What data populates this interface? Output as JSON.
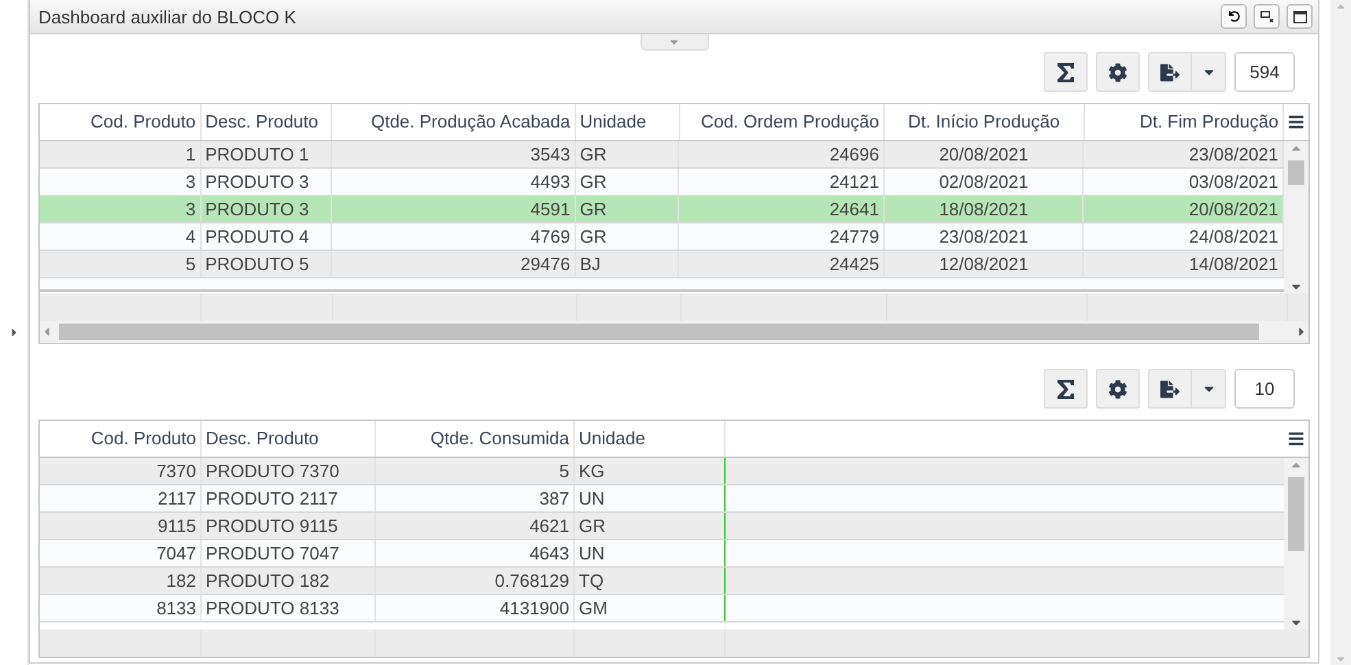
{
  "panel": {
    "title": "Dashboard auxiliar do BLOCO K"
  },
  "production_grid": {
    "record_count": "594",
    "columns": [
      "Cod. Produto",
      "Desc. Produto",
      "Qtde. Produção Acabada",
      "Unidade",
      "Cod. Ordem Produção",
      "Dt. Início Produção",
      "Dt. Fim Produção"
    ],
    "rows": [
      {
        "selected": false,
        "cells": [
          "1",
          "PRODUTO 1",
          "3543",
          "GR",
          "24696",
          "20/08/2021",
          "23/08/2021"
        ]
      },
      {
        "selected": false,
        "cells": [
          "3",
          "PRODUTO 3",
          "4493",
          "GR",
          "24121",
          "02/08/2021",
          "03/08/2021"
        ]
      },
      {
        "selected": true,
        "cells": [
          "3",
          "PRODUTO 3",
          "4591",
          "GR",
          "24641",
          "18/08/2021",
          "20/08/2021"
        ]
      },
      {
        "selected": false,
        "cells": [
          "4",
          "PRODUTO 4",
          "4769",
          "GR",
          "24779",
          "23/08/2021",
          "24/08/2021"
        ]
      },
      {
        "selected": false,
        "cells": [
          "5",
          "PRODUTO 5",
          "29476",
          "BJ",
          "24425",
          "12/08/2021",
          "14/08/2021"
        ]
      }
    ]
  },
  "consumption_grid": {
    "record_count": "10",
    "columns": [
      "Cod. Produto",
      "Desc. Produto",
      "Qtde. Consumida",
      "Unidade"
    ],
    "rows": [
      {
        "selected": false,
        "cells": [
          "7370",
          "PRODUTO 7370",
          "5",
          "KG"
        ]
      },
      {
        "selected": false,
        "cells": [
          "2117",
          "PRODUTO 2117",
          "387",
          "UN"
        ]
      },
      {
        "selected": false,
        "cells": [
          "9115",
          "PRODUTO 9115",
          "4621",
          "GR"
        ]
      },
      {
        "selected": false,
        "cells": [
          "7047",
          "PRODUTO 7047",
          "4643",
          "UN"
        ]
      },
      {
        "selected": false,
        "cells": [
          "182",
          "PRODUTO 182",
          "0.768129",
          "TQ"
        ]
      },
      {
        "selected": false,
        "cells": [
          "8133",
          "PRODUTO 8133",
          "4131900",
          "GM"
        ]
      }
    ]
  }
}
